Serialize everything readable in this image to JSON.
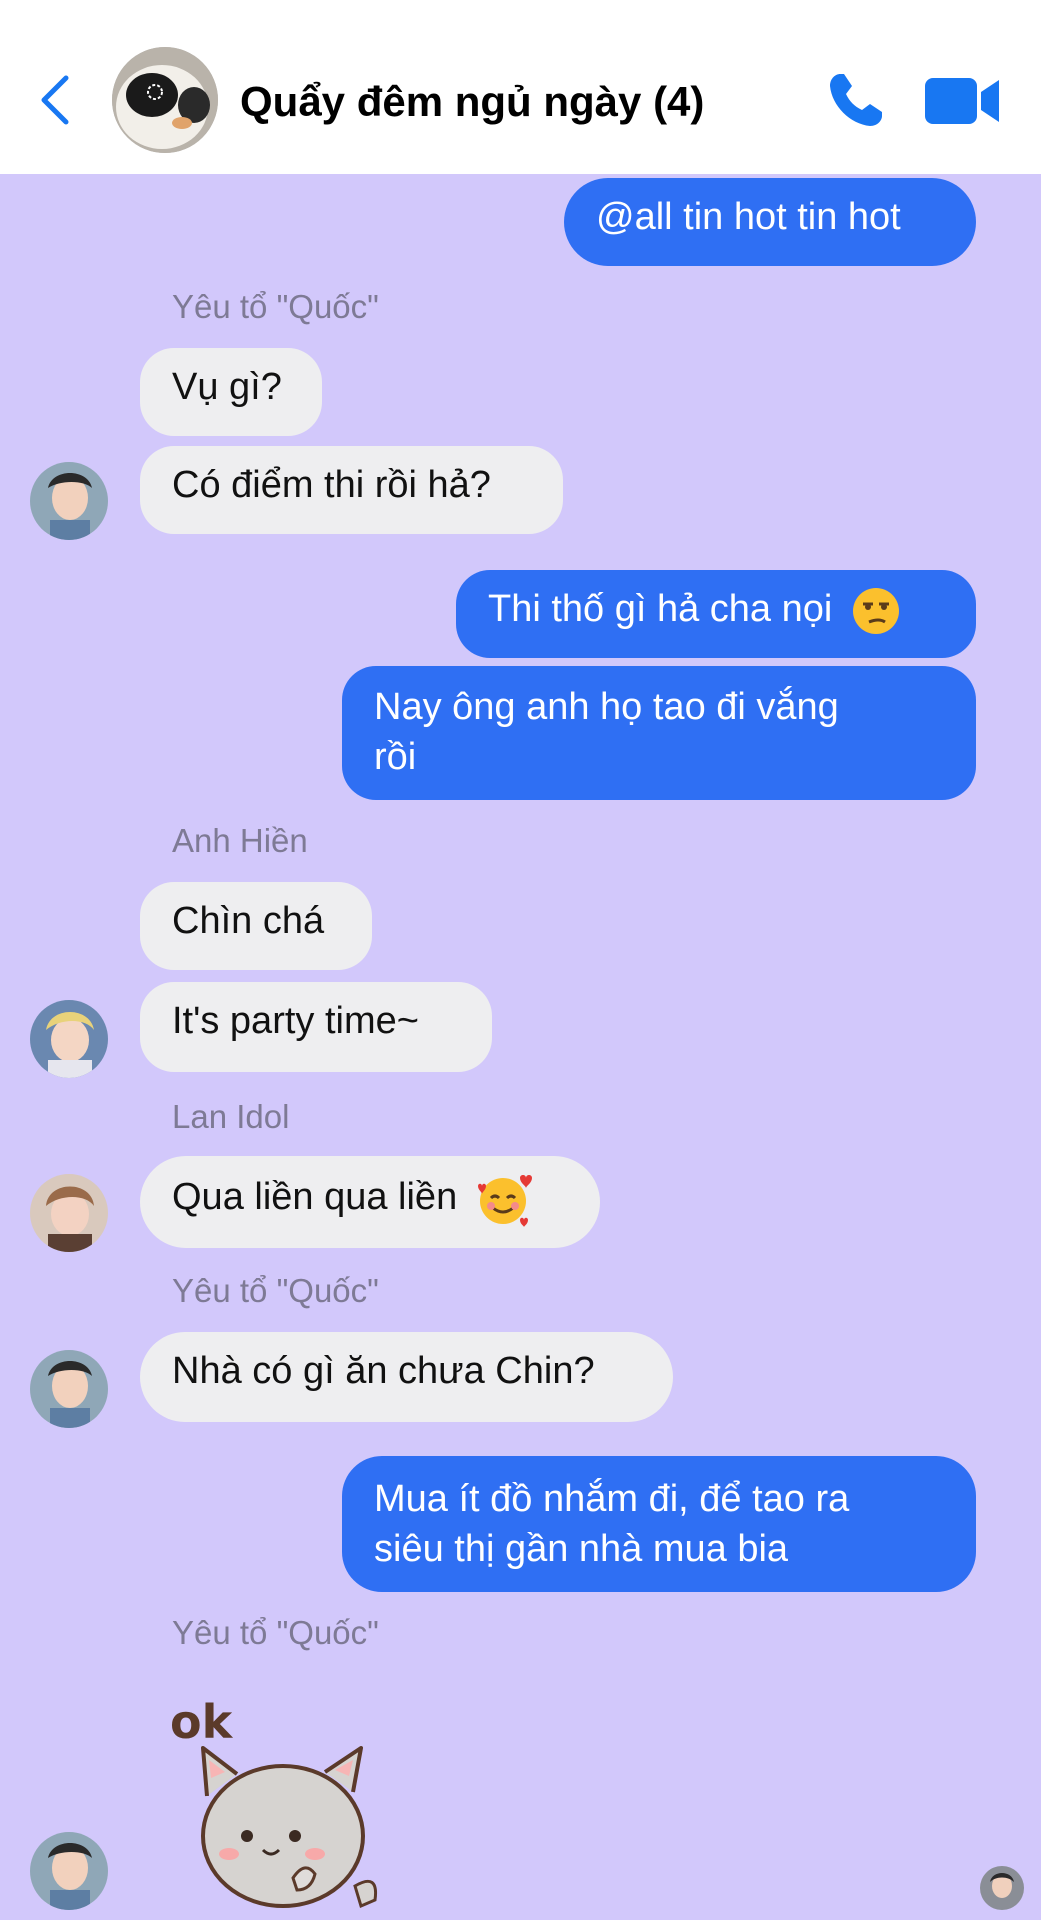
{
  "header": {
    "title": "Quẩy đêm ngủ ngày (4)",
    "back_icon": "chevron-left-icon",
    "call_icon": "phone-icon",
    "video_icon": "video-camera-icon",
    "accent": "#1877f2"
  },
  "messages": [
    {
      "type": "out",
      "text": "@all tin hot tin hot"
    },
    {
      "type": "sender",
      "text": "Yêu tổ \"Quốc\""
    },
    {
      "type": "in",
      "text": "Vụ gì?"
    },
    {
      "type": "in",
      "text": "Có điểm thi rồi hả?"
    },
    {
      "type": "out",
      "text": "Thi thố gì hả cha nọi",
      "emoji": "unamused-face"
    },
    {
      "type": "out",
      "line1": "Nay ông anh họ tao đi vắng",
      "line2": "rồi"
    },
    {
      "type": "sender",
      "text": "Anh Hiền"
    },
    {
      "type": "in",
      "text": "Chìn chá"
    },
    {
      "type": "in",
      "text": "It's party time~"
    },
    {
      "type": "sender",
      "text": "Lan Idol"
    },
    {
      "type": "in",
      "text": "Qua liền qua liền",
      "emoji": "smiling-face-with-hearts"
    },
    {
      "type": "sender",
      "text": "Yêu tổ \"Quốc\""
    },
    {
      "type": "in",
      "text": "Nhà có gì ăn chưa Chin?"
    },
    {
      "type": "out",
      "line1": "Mua ít đồ nhắm đi, để tao ra",
      "line2": "siêu thị gần nhà mua bia"
    },
    {
      "type": "sender",
      "text": "Yêu tổ \"Quốc\""
    }
  ],
  "sticker": {
    "text": "ok",
    "icon": "cat-sticker-icon"
  },
  "colors": {
    "chat_bg": "#d2c8fb",
    "outgoing": "#2f6ff3",
    "incoming": "#eeeef0"
  }
}
